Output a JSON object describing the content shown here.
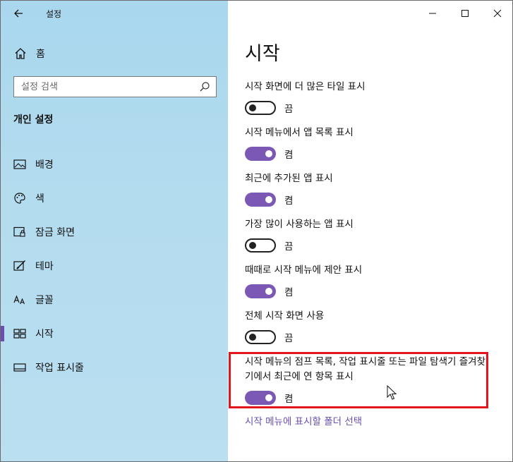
{
  "window": {
    "title": "설정"
  },
  "sidebar": {
    "home_label": "홈",
    "search_placeholder": "설정 검색",
    "section_title": "개인 설정",
    "items": [
      {
        "label": "배경",
        "icon": "image-icon",
        "active": false
      },
      {
        "label": "색",
        "icon": "palette-icon",
        "active": false
      },
      {
        "label": "잠금 화면",
        "icon": "lock-screen-icon",
        "active": false
      },
      {
        "label": "테마",
        "icon": "theme-brush-icon",
        "active": false
      },
      {
        "label": "글꼴",
        "icon": "font-icon",
        "active": false
      },
      {
        "label": "시작",
        "icon": "start-grid-icon",
        "active": true
      },
      {
        "label": "작업 표시줄",
        "icon": "taskbar-icon",
        "active": false
      }
    ]
  },
  "main": {
    "title": "시작",
    "settings": [
      {
        "label": "시작 화면에 더 많은 타일 표시",
        "state": "off",
        "state_label": "끔"
      },
      {
        "label": "시작 메뉴에서 앱 목록 표시",
        "state": "on",
        "state_label": "켬"
      },
      {
        "label": "최근에 추가된 앱 표시",
        "state": "on",
        "state_label": "켬"
      },
      {
        "label": "가장 많이 사용하는 앱 표시",
        "state": "off",
        "state_label": "끔"
      },
      {
        "label": "때때로 시작 메뉴에 제안 표시",
        "state": "on",
        "state_label": "켬"
      },
      {
        "label": "전체 시작 화면 사용",
        "state": "off",
        "state_label": "끔"
      },
      {
        "label": "시작 메뉴의 점프 목록, 작업 표시줄 또는 파일 탐색기 즐겨찾기에서 최근에 연 항목 표시",
        "state": "on",
        "state_label": "켬"
      }
    ],
    "link_label": "시작 메뉴에 표시할 폴더 선택"
  },
  "colors": {
    "accent": "#7a58b4",
    "highlight": "#e0161c",
    "sidebar_bg": "#b4dcef"
  }
}
